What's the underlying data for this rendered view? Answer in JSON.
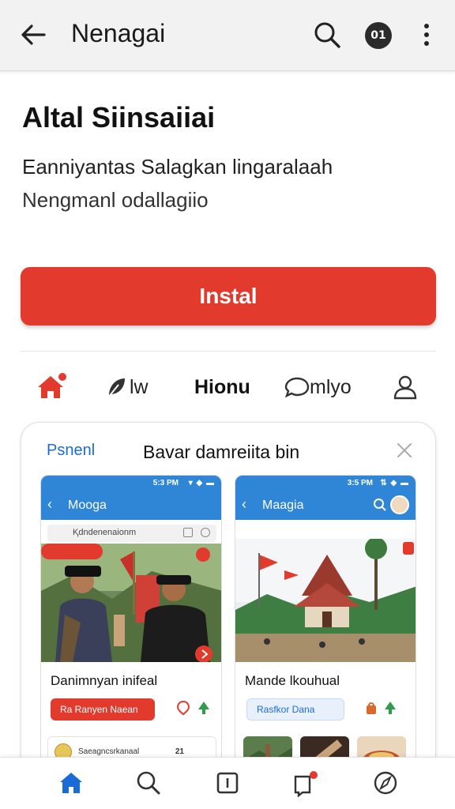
{
  "appbar": {
    "title": "Nenagai",
    "avatar_text": "01"
  },
  "app": {
    "name": "Altal Siinsaiiai",
    "description_line1": "Eanniyantas  Salagkan lingaralaah",
    "description_line2": "Nengmanl odallagiio",
    "install_label": "Instal"
  },
  "tabs": [
    {
      "label": "",
      "icon": "home-icon",
      "active": true
    },
    {
      "label": "lw",
      "icon": "leaf-icon"
    },
    {
      "label": "Hionu",
      "icon": ""
    },
    {
      "label": "mlyo",
      "icon": "chat-bubble-icon"
    },
    {
      "label": "",
      "icon": "person-icon"
    }
  ],
  "card": {
    "panel_label": "Psnenl",
    "title": "Bavar damreiita bin",
    "phones": [
      {
        "time": "5:3 PM",
        "app_name": "Mooga",
        "search_text": "Ⱪdndenenaionm",
        "post_title": "Danimnyan inifeal",
        "pill": "Ra Ranyen Naean",
        "row_text": "Saeagncsrkanaal",
        "row_num": "21"
      },
      {
        "time": "3:5 PM",
        "app_name": "Maagia",
        "post_title": "Mande lkouhual",
        "pill": "Rasfkor Dana"
      }
    ]
  },
  "colors": {
    "accent": "#e23b2e",
    "blue": "#2f86d6",
    "nav_active": "#1b6bd6"
  },
  "bottom_nav": [
    "home-icon",
    "search-icon",
    "plus-box-icon",
    "notification-icon",
    "compass-icon"
  ]
}
